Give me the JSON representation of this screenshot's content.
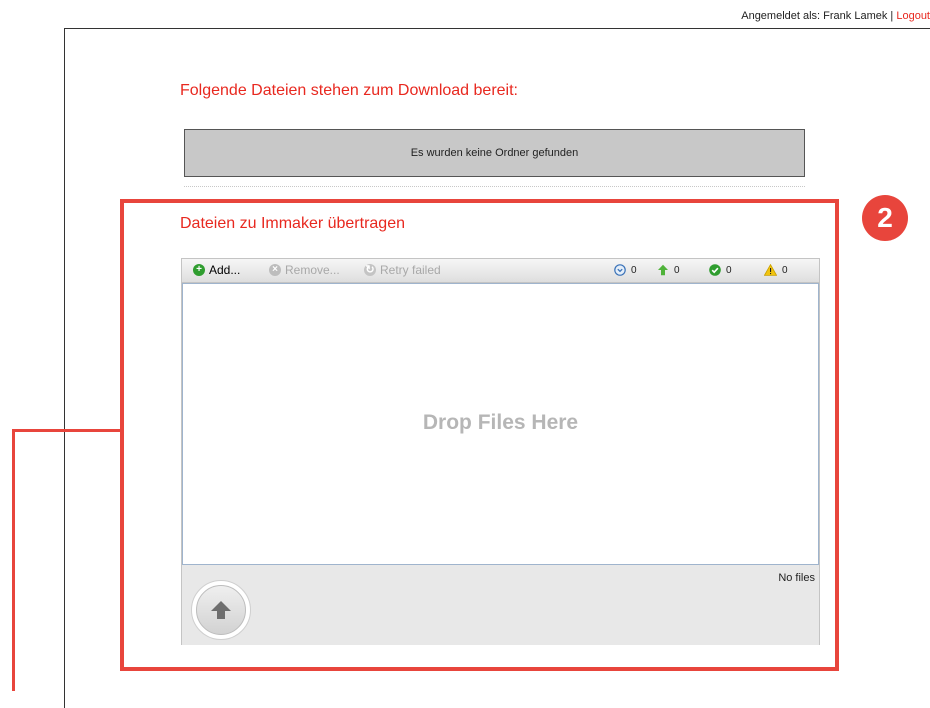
{
  "header": {
    "logged_in_label": "Angemeldet als: Frank Lamek |",
    "logout_label": "Logout"
  },
  "downloads": {
    "title": "Folgende Dateien stehen zum Download bereit:",
    "empty_message": "Es wurden keine Ordner gefunden"
  },
  "upload": {
    "title": "Dateien zu Immaker übertragen",
    "toolbar": {
      "add_label": "Add...",
      "remove_label": "Remove...",
      "retry_label": "Retry failed",
      "queued_count": "0",
      "uploading_count": "0",
      "done_count": "0",
      "failed_count": "0"
    },
    "drop_text": "Drop Files Here",
    "status_text": "No files"
  },
  "callout": {
    "number": "2"
  },
  "colors": {
    "accent": "#e8281f",
    "callout": "#e8453c"
  }
}
